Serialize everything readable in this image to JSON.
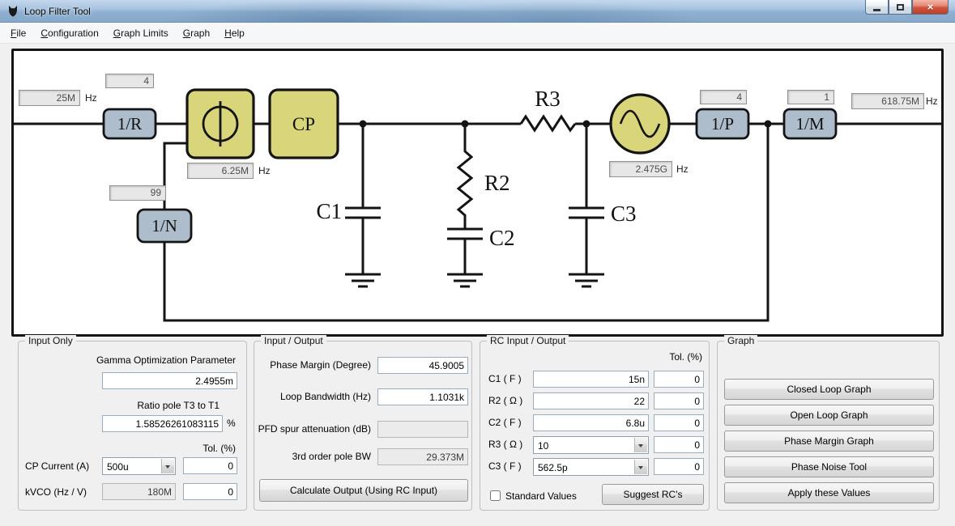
{
  "window": {
    "title": "Loop Filter Tool"
  },
  "icons": {
    "close_glyph": "×"
  },
  "menubar": {
    "items": [
      {
        "label": "File"
      },
      {
        "label": "Configuration"
      },
      {
        "label": "Graph Limits"
      },
      {
        "label": "Graph"
      },
      {
        "label": "Help"
      }
    ]
  },
  "diagram": {
    "hz_label": "Hz",
    "ref_freq": "25M",
    "r_div": "4",
    "n_div": "99",
    "pfd_freq": "6.25M",
    "vco_freq": "2.475G",
    "p_div": "4",
    "m_div": "1",
    "out_freq": "618.75M",
    "blocks": {
      "r": "1/R",
      "n": "1/N",
      "p": "1/P",
      "m": "1/M",
      "cp": "CP"
    },
    "components": {
      "c1": "C1",
      "r2": "R2",
      "c2": "C2",
      "r3": "R3",
      "c3": "C3"
    }
  },
  "input_only": {
    "title": "Input Only",
    "gamma_label": "Gamma Optimization Parameter",
    "gamma_value": "2.4955m",
    "ratio_label": "Ratio pole T3 to T1",
    "ratio_value": "1.58526261083115",
    "ratio_unit": "%",
    "tol_header": "Tol. (%)",
    "cp_label": "CP Current (A)",
    "cp_value": "500u",
    "cp_tol": "0",
    "kvco_label": "kVCO (Hz / V)",
    "kvco_value": "180M",
    "kvco_tol": "0"
  },
  "input_output": {
    "title": "Input / Output",
    "rows": [
      {
        "label": "Phase Margin (Degree)",
        "value": "45.9005"
      },
      {
        "label": "Loop Bandwidth (Hz)",
        "value": "1.1031k"
      },
      {
        "label": "PFD spur attenuation (dB)",
        "value": ""
      },
      {
        "label": "3rd order pole BW",
        "value": "29.373M"
      }
    ],
    "calc_button": "Calculate Output (Using RC Input)"
  },
  "rc": {
    "title": "RC Input / Output",
    "tol_header": "Tol. (%)",
    "rows": [
      {
        "label": "C1 ( F )",
        "value": "15n",
        "tol": "0"
      },
      {
        "label": "R2 ( Ω )",
        "value": "22",
        "tol": "0"
      },
      {
        "label": "C2 ( F )",
        "value": "6.8u",
        "tol": "0"
      },
      {
        "label": "R3 ( Ω )",
        "value": "10",
        "tol": "0"
      },
      {
        "label": "C3 ( F )",
        "value": "562.5p",
        "tol": "0"
      }
    ],
    "standard_label": "Standard Values",
    "suggest_button": "Suggest RC's"
  },
  "graph": {
    "title": "Graph",
    "buttons": [
      "Closed Loop Graph",
      "Open Loop Graph",
      "Phase Margin Graph",
      "Phase Noise Tool",
      "Apply these Values"
    ]
  }
}
